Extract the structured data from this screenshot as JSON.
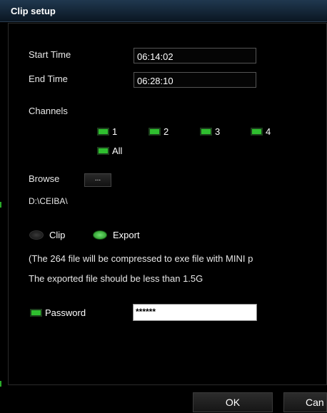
{
  "window": {
    "title": "Clip setup"
  },
  "times": {
    "start_label": "Start Time",
    "start_value": "06:14:02",
    "end_label": "End Time",
    "end_value": "06:28:10"
  },
  "channels": {
    "label": "Channels",
    "items": [
      "1",
      "2",
      "3",
      "4"
    ],
    "all_label": "All",
    "checked_color": "#2fbf2f"
  },
  "browse": {
    "label": "Browse",
    "button_label": "...",
    "path": "D:\\CEIBA\\"
  },
  "mode": {
    "clip_label": "Clip",
    "export_label": "Export",
    "selected": "Export"
  },
  "info": {
    "line1": "(The 264 file will be compressed to exe file with MINI p",
    "line2": "The exported file should be less than 1.5G"
  },
  "password": {
    "label": "Password",
    "value": "******",
    "checked": true
  },
  "buttons": {
    "ok_label": "OK",
    "cancel_label": "Can"
  }
}
